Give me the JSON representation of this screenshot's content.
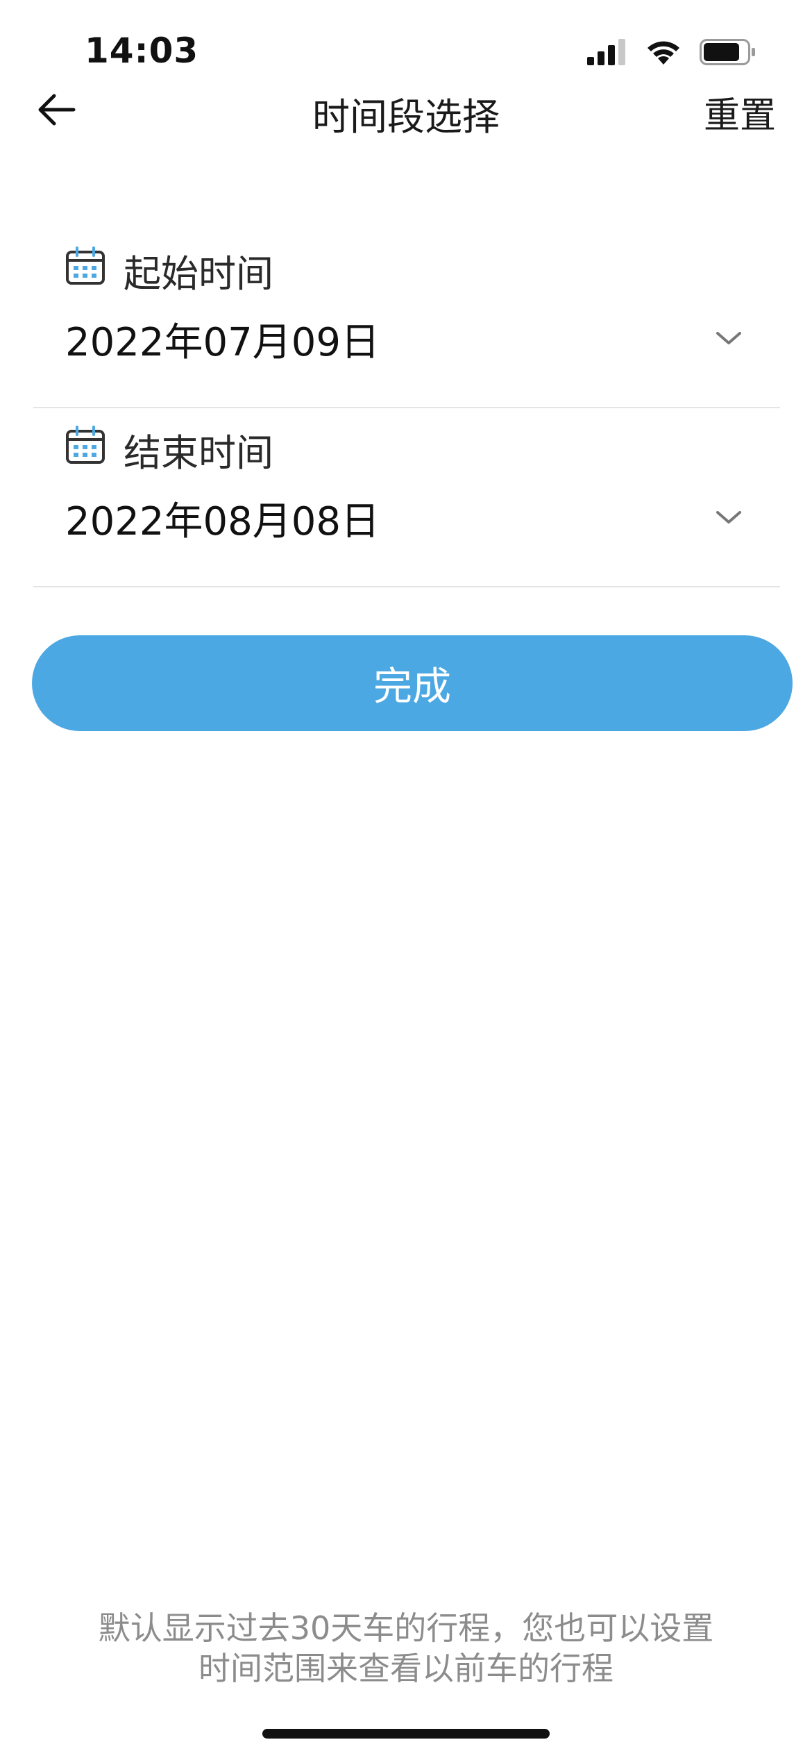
{
  "status_bar": {
    "time": "14:03",
    "icons": [
      "cellular-signal-icon",
      "wifi-icon",
      "battery-icon"
    ]
  },
  "nav": {
    "back_icon": "arrow-left-icon",
    "title": "时间段选择",
    "reset_label": "重置"
  },
  "start": {
    "icon": "calendar-icon",
    "label": "起始时间",
    "value": "2022年07月09日"
  },
  "end": {
    "icon": "calendar-icon",
    "label": "结束时间",
    "value": "2022年08月08日"
  },
  "done_label": "完成",
  "footer": {
    "line1": "默认显示过去30天车的行程，您也可以设置",
    "line2": "时间范围来查看以前车的行程"
  },
  "colors": {
    "accent": "#4ca8e3",
    "divider": "#e4e4e4",
    "muted_text": "#8c8c8c"
  }
}
